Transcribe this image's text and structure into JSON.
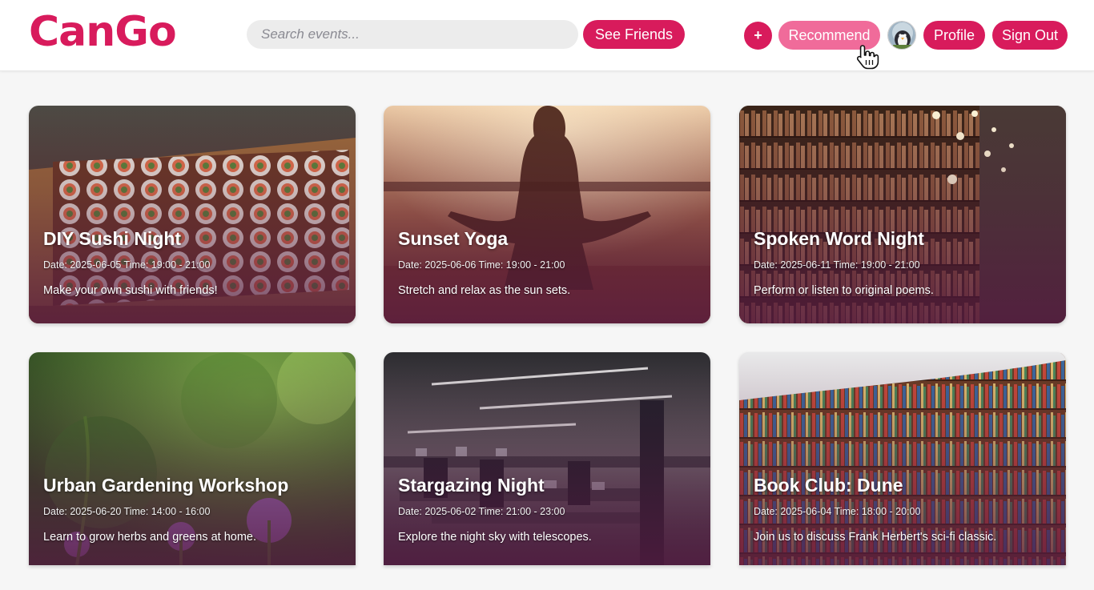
{
  "colors": {
    "brand": "#d81b5c",
    "recommend": "#f06b9a",
    "header_bg": "#ffffff",
    "page_bg": "#f6f6f6"
  },
  "header": {
    "logo": "CanGo",
    "search": {
      "placeholder": "Search events...",
      "value": ""
    },
    "see_friends_label": "See Friends",
    "add_label": "+",
    "recommend_label": "Recommend",
    "profile_label": "Profile",
    "sign_out_label": "Sign Out",
    "avatar_icon": "penguin-avatar-icon"
  },
  "events": [
    {
      "title": "DIY Sushi Night",
      "date": "Date: 2025-06-05 Time: 19:00 - 21:00",
      "description": "Make your own sushi with friends!",
      "image": "sushi-platter-photo"
    },
    {
      "title": "Sunset Yoga",
      "date": "Date: 2025-06-06 Time: 19:00 - 21:00",
      "description": "Stretch and relax as the sun sets.",
      "image": "yoga-silhouette-photo"
    },
    {
      "title": "Spoken Word Night",
      "date": "Date: 2025-06-11 Time: 19:00 - 21:00",
      "description": "Perform or listen to original poems.",
      "image": "library-shelves-photo"
    },
    {
      "title": "Urban Gardening Workshop",
      "date": "Date: 2025-06-20 Time: 14:00 - 16:00",
      "description": "Learn to grow herbs and greens at home.",
      "image": "garden-plants-photo"
    },
    {
      "title": "Stargazing Night",
      "date": "Date: 2025-06-02 Time: 21:00 - 23:00",
      "description": "Explore the night sky with telescopes.",
      "image": "computer-lab-photo"
    },
    {
      "title": "Book Club: Dune",
      "date": "Date: 2025-06-04 Time: 18:00 - 20:00",
      "description": "Join us to discuss Frank Herbert's sci-fi classic.",
      "image": "curved-bookshelf-photo"
    }
  ]
}
